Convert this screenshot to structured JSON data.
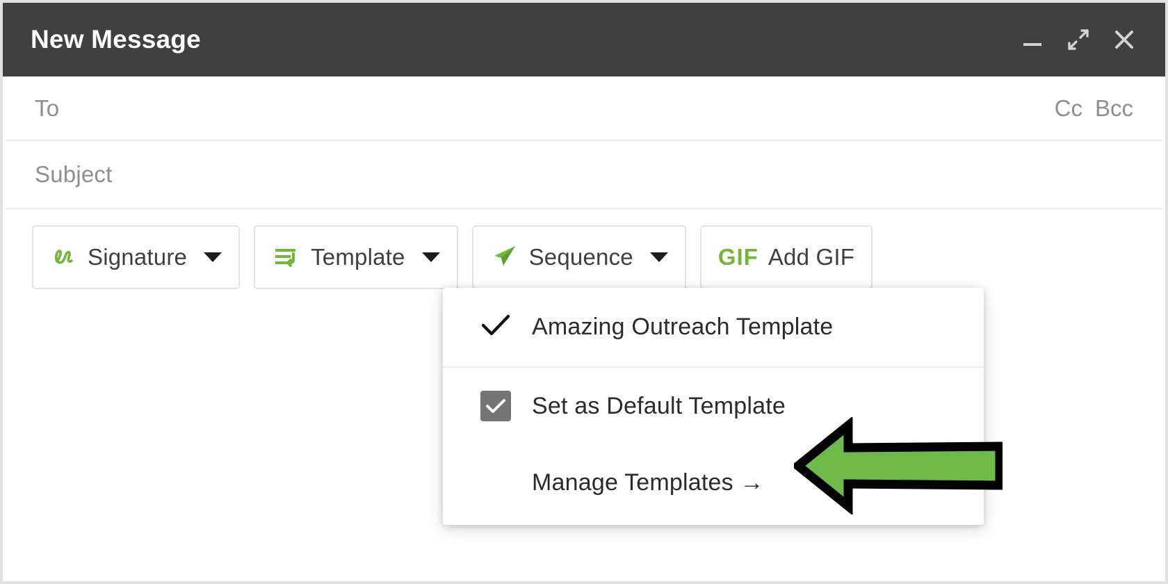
{
  "window": {
    "title": "New Message",
    "controls": [
      {
        "name": "minimize",
        "label": "Minimize"
      },
      {
        "name": "expand",
        "label": "Full screen"
      },
      {
        "name": "close",
        "label": "Close"
      }
    ]
  },
  "compose": {
    "to": {
      "label": "To",
      "value": "",
      "placeholder": "To"
    },
    "cc_label": "Cc",
    "bcc_label": "Bcc",
    "subject": {
      "label": "Subject",
      "value": "",
      "placeholder": "Subject"
    }
  },
  "toolbar": {
    "buttons": [
      {
        "id": "signature",
        "label": "Signature",
        "icon": "signature-icon",
        "has_caret": true
      },
      {
        "id": "template",
        "label": "Template",
        "icon": "template-icon",
        "has_caret": true
      },
      {
        "id": "sequence",
        "label": "Sequence",
        "icon": "paper-plane-icon",
        "has_caret": true
      },
      {
        "id": "add-gif",
        "label": "Add GIF",
        "icon": "gif-icon",
        "badge": "GIF",
        "has_caret": false
      }
    ]
  },
  "template_menu": {
    "templates": [
      {
        "label": "Amazing Outreach Template",
        "selected": true
      }
    ],
    "set_default": {
      "label": "Set as Default Template",
      "checked": true
    },
    "manage": {
      "label": "Manage Templates →"
    }
  },
  "annotation": {
    "type": "arrow",
    "direction": "left",
    "points_at": "Manage Templates →",
    "fill_color": "#6fb84a",
    "stroke_color": "#000000"
  },
  "colors": {
    "titlebar_bg": "#404040",
    "accent_green": "#74b738",
    "annotation_green": "#6fb84a",
    "placeholder_gray": "#8e8e8e",
    "checkbox_gray": "#757575",
    "divider": "#ececec",
    "window_border": "#e2e2e2"
  }
}
